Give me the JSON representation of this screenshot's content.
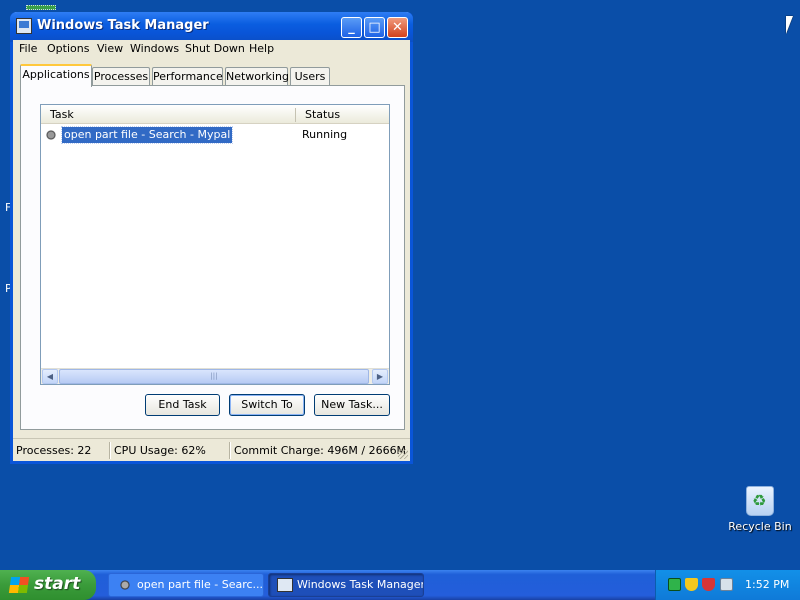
{
  "window": {
    "title": "Windows Task Manager",
    "controls": {
      "minimize": "_",
      "maximize": "□",
      "close": "✕"
    }
  },
  "menu": [
    "File",
    "Options",
    "View",
    "Windows",
    "Shut Down",
    "Help"
  ],
  "tabs": [
    "Applications",
    "Processes",
    "Performance",
    "Networking",
    "Users"
  ],
  "active_tab": "Applications",
  "list": {
    "columns": [
      "Task",
      "Status"
    ],
    "rows": [
      {
        "task": "open part file - Search - Mypal",
        "status": "Running",
        "icon": "mypal-app-icon",
        "selected": true
      }
    ]
  },
  "buttons": {
    "end_task": "End Task",
    "switch_to": "Switch To",
    "new_task": "New Task..."
  },
  "status_bar": {
    "processes": "Processes: 22",
    "cpu": "CPU Usage: 62%",
    "commit": "Commit Charge: 496M / 2666M"
  },
  "desktop": {
    "recycle_bin_label": "Recycle Bin",
    "fragments": [
      "F",
      "P"
    ]
  },
  "taskbar": {
    "start_label": "start",
    "items": [
      {
        "label": "open part file - Searc...",
        "icon": "mypal-app-icon",
        "active": false
      },
      {
        "label": "Windows Task Manager",
        "icon": "task-manager-icon",
        "active": true
      }
    ],
    "clock": "1:52 PM",
    "tray_icons": [
      "network-icon",
      "security-shield-icon",
      "security-alert-icon",
      "safely-remove-hardware-icon"
    ]
  },
  "colors": {
    "desktop": "#0a4ea8",
    "title_bar": "#0955d8",
    "selection": "#316ac5",
    "start_button": "#3a9b3a"
  }
}
